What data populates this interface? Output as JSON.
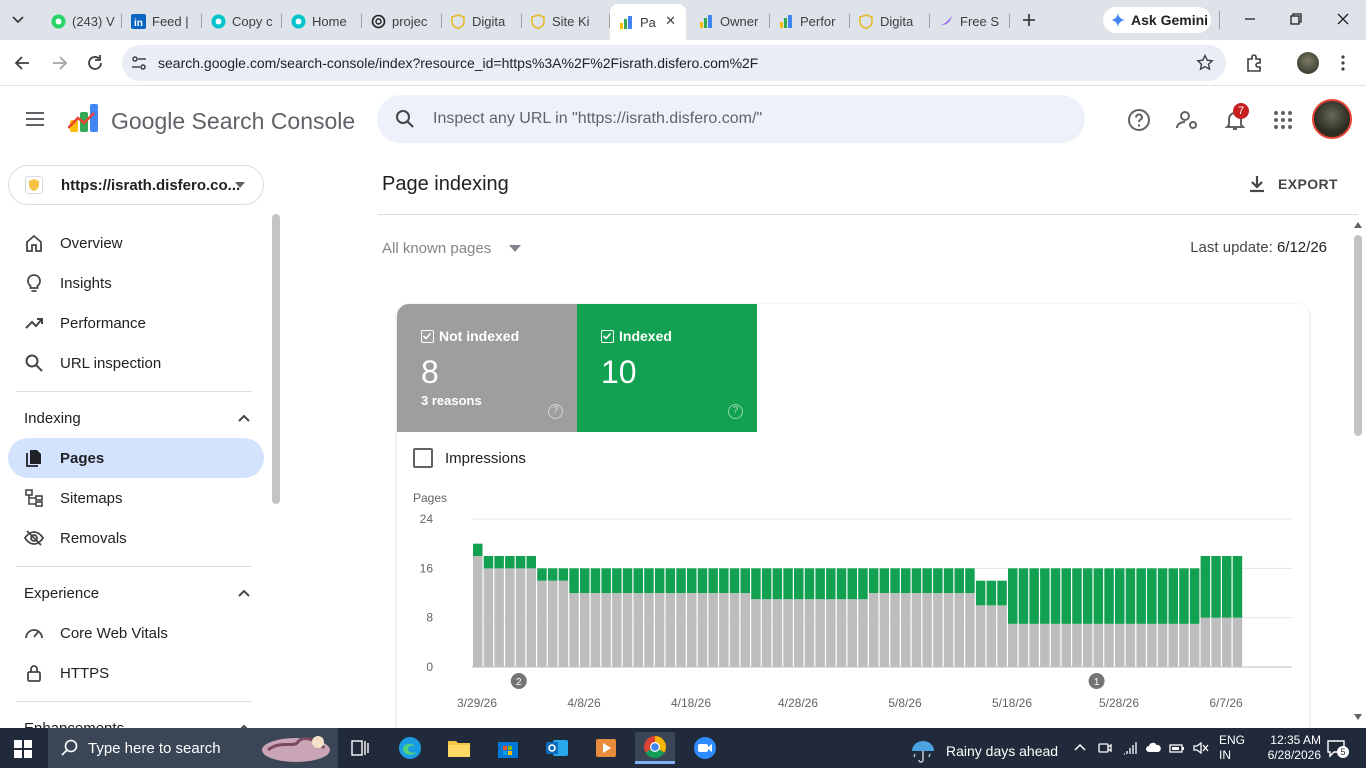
{
  "browser": {
    "tabs": [
      {
        "title": "(243) V",
        "icon": "whatsapp-icon",
        "color": "#25d366"
      },
      {
        "title": "Feed |",
        "icon": "linkedin-icon",
        "color": "#0a66c2"
      },
      {
        "title": "Copy c",
        "icon": "canva-icon",
        "color": "#00c4cc"
      },
      {
        "title": "Home",
        "icon": "canva-icon",
        "color": "#00c4cc"
      },
      {
        "title": "projec",
        "icon": "openai-icon",
        "color": "#202124"
      },
      {
        "title": "Digita",
        "icon": "shield-icon",
        "color": "#e8b923"
      },
      {
        "title": "Site Ki",
        "icon": "shield-icon",
        "color": "#e8b923"
      },
      {
        "title": "Pa",
        "icon": "search-console-icon",
        "color": "#4285f4",
        "active": true
      },
      {
        "title": "Owner",
        "icon": "search-console-icon",
        "color": "#4285f4"
      },
      {
        "title": "Perfor",
        "icon": "search-console-icon",
        "color": "#4285f4"
      },
      {
        "title": "Digita",
        "icon": "shield-icon",
        "color": "#e8b923"
      },
      {
        "title": "Free S",
        "icon": "gemini-star-icon",
        "color": "#8e5cf7"
      }
    ],
    "gemini_label": "Ask Gemini",
    "url": "search.google.com/search-console/index?resource_id=https%3A%2F%2Fisrath.disfero.com%2F"
  },
  "header": {
    "product": "Google Search Console",
    "inspect_placeholder": "Inspect any URL in \"https://israth.disfero.com/\"",
    "notification_count": "7"
  },
  "sidebar": {
    "property": "https://israth.disfero.co...",
    "top_items": [
      {
        "label": "Overview",
        "icon": "home-icon"
      },
      {
        "label": "Insights",
        "icon": "lightbulb-icon"
      },
      {
        "label": "Performance",
        "icon": "trending-icon"
      },
      {
        "label": "URL inspection",
        "icon": "search-icon"
      }
    ],
    "indexing": {
      "heading": "Indexing",
      "items": [
        {
          "label": "Pages",
          "icon": "pages-icon",
          "selected": true
        },
        {
          "label": "Sitemaps",
          "icon": "sitemap-icon"
        },
        {
          "label": "Removals",
          "icon": "removals-icon"
        }
      ]
    },
    "experience": {
      "heading": "Experience",
      "items": [
        {
          "label": "Core Web Vitals",
          "icon": "gauge-icon"
        },
        {
          "label": "HTTPS",
          "icon": "lock-icon"
        }
      ]
    },
    "enhancements_heading": "Enhancements"
  },
  "main": {
    "title": "Page indexing",
    "export_label": "EXPORT",
    "filter": "All known pages",
    "last_update_label": "Last update: ",
    "last_update_value": "6/12/26",
    "not_indexed": {
      "label": "Not indexed",
      "value": "8",
      "sub": "3 reasons",
      "color": "#9e9e9e"
    },
    "indexed": {
      "label": "Indexed",
      "value": "10",
      "color": "#12a150"
    },
    "impressions_label": "Impressions",
    "help_glyph": "?"
  },
  "chart_data": {
    "type": "bar",
    "stacked": true,
    "ylabel": "Pages",
    "ylim": [
      0,
      24
    ],
    "yticks": [
      0,
      8,
      16,
      24
    ],
    "x_tick_labels": [
      "3/29/26",
      "4/8/26",
      "4/18/26",
      "4/28/26",
      "5/8/26",
      "5/18/26",
      "5/28/26",
      "6/7/26"
    ],
    "x_tick_day_index": [
      0,
      10,
      20,
      30,
      40,
      50,
      60,
      70
    ],
    "annotations": [
      {
        "day_index": 4,
        "label": "2"
      },
      {
        "day_index": 58,
        "label": "1"
      }
    ],
    "grid": true,
    "series": [
      {
        "name": "Not indexed",
        "color": "#bdbdbd",
        "values": [
          18,
          16,
          16,
          16,
          16,
          16,
          14,
          14,
          14,
          12,
          12,
          12,
          12,
          12,
          12,
          12,
          12,
          12,
          12,
          12,
          12,
          12,
          12,
          12,
          12,
          12,
          11,
          11,
          11,
          11,
          11,
          11,
          11,
          11,
          11,
          11,
          11,
          12,
          12,
          12,
          12,
          12,
          12,
          12,
          12,
          12,
          12,
          10,
          10,
          10,
          7,
          7,
          7,
          7,
          7,
          7,
          7,
          7,
          7,
          7,
          7,
          7,
          7,
          7,
          7,
          7,
          7,
          7,
          8,
          8,
          8,
          8
        ]
      },
      {
        "name": "Indexed",
        "color": "#12a150",
        "values": [
          2,
          2,
          2,
          2,
          2,
          2,
          2,
          2,
          2,
          4,
          4,
          4,
          4,
          4,
          4,
          4,
          4,
          4,
          4,
          4,
          4,
          4,
          4,
          4,
          4,
          4,
          5,
          5,
          5,
          5,
          5,
          5,
          5,
          5,
          5,
          5,
          5,
          4,
          4,
          4,
          4,
          4,
          4,
          4,
          4,
          4,
          4,
          4,
          4,
          4,
          9,
          9,
          9,
          9,
          9,
          9,
          9,
          9,
          9,
          9,
          9,
          9,
          9,
          9,
          9,
          9,
          9,
          9,
          10,
          10,
          10,
          10
        ]
      }
    ]
  },
  "taskbar": {
    "search_placeholder": "Type here to search",
    "weather": "Rainy days ahead",
    "lang_line1": "ENG",
    "lang_line2": "IN",
    "time": "12:35 AM",
    "date": "6/28/2026",
    "notification_count": "5"
  }
}
